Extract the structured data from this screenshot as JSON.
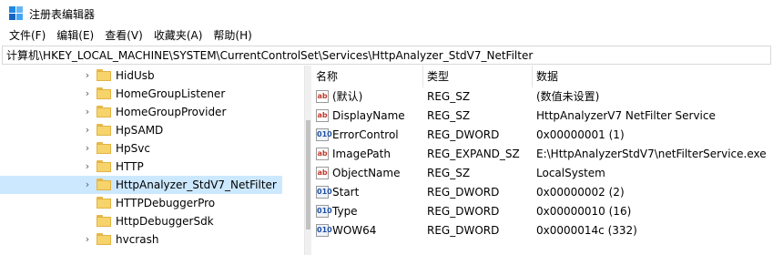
{
  "window": {
    "title": "注册表编辑器"
  },
  "menu": [
    "文件(F)",
    "编辑(E)",
    "查看(V)",
    "收藏夹(A)",
    "帮助(H)"
  ],
  "address": "计算机\\HKEY_LOCAL_MACHINE\\SYSTEM\\CurrentControlSet\\Services\\HttpAnalyzer_StdV7_NetFilter",
  "tree": {
    "items": [
      {
        "label": "HidUsb",
        "expandable": true,
        "selected": false
      },
      {
        "label": "HomeGroupListener",
        "expandable": true,
        "selected": false
      },
      {
        "label": "HomeGroupProvider",
        "expandable": true,
        "selected": false
      },
      {
        "label": "HpSAMD",
        "expandable": true,
        "selected": false
      },
      {
        "label": "HpSvc",
        "expandable": true,
        "selected": false
      },
      {
        "label": "HTTP",
        "expandable": true,
        "selected": false
      },
      {
        "label": "HttpAnalyzer_StdV7_NetFilter",
        "expandable": true,
        "selected": true
      },
      {
        "label": "HTTPDebuggerPro",
        "expandable": false,
        "selected": false
      },
      {
        "label": "HttpDebuggerSdk",
        "expandable": false,
        "selected": false
      },
      {
        "label": "hvcrash",
        "expandable": true,
        "selected": false
      }
    ]
  },
  "list": {
    "headers": {
      "name": "名称",
      "type": "类型",
      "data": "数据"
    },
    "rows": [
      {
        "icon": "string-value-icon",
        "glyph": "ab",
        "name": "(默认)",
        "type": "REG_SZ",
        "data": "(数值未设置)"
      },
      {
        "icon": "string-value-icon",
        "glyph": "ab",
        "name": "DisplayName",
        "type": "REG_SZ",
        "data": "HttpAnalyzerV7 NetFilter Service"
      },
      {
        "icon": "binary-value-icon",
        "glyph": "010",
        "name": "ErrorControl",
        "type": "REG_DWORD",
        "data": "0x00000001 (1)"
      },
      {
        "icon": "string-value-icon",
        "glyph": "ab",
        "name": "ImagePath",
        "type": "REG_EXPAND_SZ",
        "data": "E:\\HttpAnalyzerStdV7\\netFilterService.exe"
      },
      {
        "icon": "string-value-icon",
        "glyph": "ab",
        "name": "ObjectName",
        "type": "REG_SZ",
        "data": "LocalSystem"
      },
      {
        "icon": "binary-value-icon",
        "glyph": "010",
        "name": "Start",
        "type": "REG_DWORD",
        "data": "0x00000002 (2)"
      },
      {
        "icon": "binary-value-icon",
        "glyph": "010",
        "name": "Type",
        "type": "REG_DWORD",
        "data": "0x00000010 (16)"
      },
      {
        "icon": "binary-value-icon",
        "glyph": "010",
        "name": "WOW64",
        "type": "REG_DWORD",
        "data": "0x0000014c (332)"
      }
    ]
  },
  "colors": {
    "selection": "#cce8ff",
    "folder": "#f7d36b"
  }
}
